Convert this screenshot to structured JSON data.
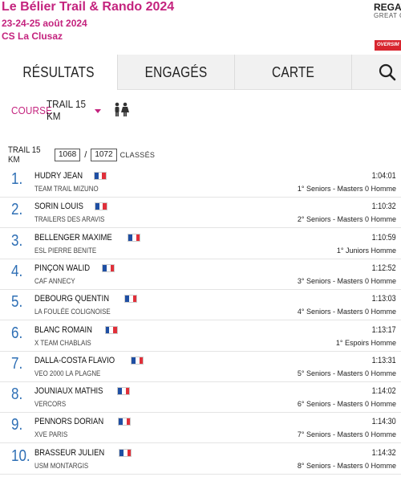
{
  "event": {
    "title": "Le Bélier Trail & Rando 2024",
    "dates": "23-24-25 août 2024",
    "club": "CS La Clusaz"
  },
  "sponsor": {
    "name": "REGAT",
    "subtitle": "GREAT C",
    "badge": "OVERSIM"
  },
  "tabs": [
    {
      "label": "RÉSULTATS",
      "active": true
    },
    {
      "label": "ENGAGÉS",
      "active": false
    },
    {
      "label": "CARTE",
      "active": false
    }
  ],
  "search": {
    "icon": "search-icon"
  },
  "filter": {
    "label": "COURSE",
    "value": "TRAIL 15 KM",
    "gender_icon": "male-female-icon"
  },
  "summary": {
    "race": "TRAIL 15 KM",
    "ranked": "1068",
    "separator": "/",
    "total": "1072",
    "classes_label": "CLASSÉS"
  },
  "colors": {
    "brand": "#c4237e",
    "rank": "#2e6fb5",
    "tabbar": "#f1f1f1"
  },
  "results": [
    {
      "rank": "1.",
      "name": "HUDRY JEAN",
      "country": "FR",
      "club": "TEAM TRAIL MIZUNO",
      "time": "1:04:01",
      "category": "1° Seniors - Masters 0 Homme"
    },
    {
      "rank": "2.",
      "name": "SORIN LOUIS",
      "country": "FR",
      "club": "TRAILERS DES ARAVIS",
      "time": "1:10:32",
      "category": "2° Seniors - Masters 0 Homme"
    },
    {
      "rank": "3.",
      "name": "BELLENGER MAXIME",
      "country": "FR",
      "club": "ESL PIERRE BENITE",
      "time": "1:10:59",
      "category": "1° Juniors Homme"
    },
    {
      "rank": "4.",
      "name": "PINÇON WALID",
      "country": "FR",
      "club": "CAF ANNECY",
      "time": "1:12:52",
      "category": "3° Seniors - Masters 0 Homme"
    },
    {
      "rank": "5.",
      "name": "DEBOURG QUENTIN",
      "country": "FR",
      "club": "LA FOULÉE COLIGNOISE",
      "time": "1:13:03",
      "category": "4° Seniors - Masters 0 Homme"
    },
    {
      "rank": "6.",
      "name": "BLANC ROMAIN",
      "country": "FR",
      "club": "X TEAM CHABLAIS",
      "time": "1:13:17",
      "category": "1° Espoirs Homme"
    },
    {
      "rank": "7.",
      "name": "DALLA-COSTA FLAVIO",
      "country": "FR",
      "club": "VEO 2000 LA PLAGNE",
      "time": "1:13:31",
      "category": "5° Seniors - Masters 0 Homme"
    },
    {
      "rank": "8.",
      "name": "JOUNIAUX MATHIS",
      "country": "FR",
      "club": "VERCORS",
      "time": "1:14:02",
      "category": "6° Seniors - Masters 0 Homme"
    },
    {
      "rank": "9.",
      "name": "PENNORS DORIAN",
      "country": "FR",
      "club": "XVE PARIS",
      "time": "1:14:30",
      "category": "7° Seniors - Masters 0 Homme"
    },
    {
      "rank": "10.",
      "name": "BRASSEUR JULIEN",
      "country": "FR",
      "club": "USM MONTARGIS",
      "time": "1:14:32",
      "category": "8° Seniors - Masters 0 Homme"
    }
  ]
}
